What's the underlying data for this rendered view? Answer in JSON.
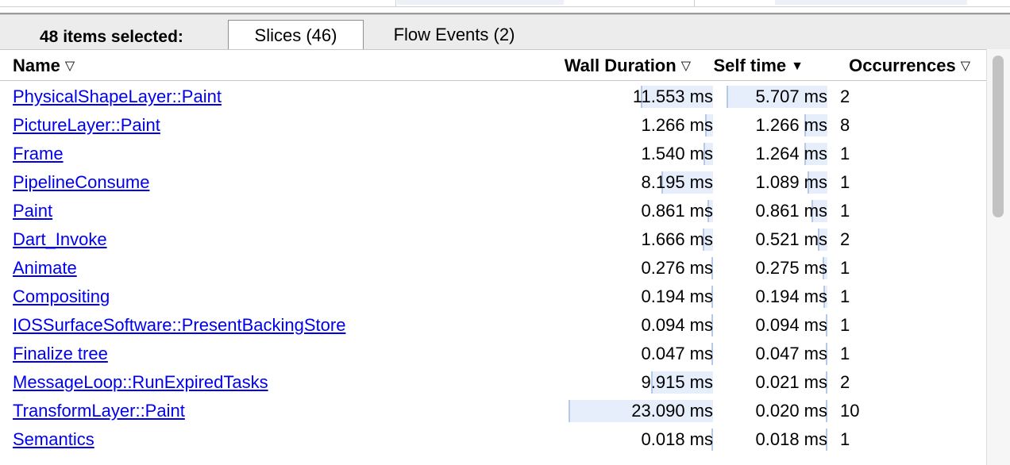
{
  "tabbar": {
    "selection_label": "48 items selected:",
    "tabs": [
      {
        "label": "Slices (46)"
      },
      {
        "label": "Flow Events (2)"
      }
    ]
  },
  "columns": {
    "name": "Name",
    "wall": "Wall Duration",
    "self": "Self time",
    "occ": "Occurrences",
    "sort_icons": {
      "name": "triangle-down-outline-icon",
      "wall": "triangle-down-outline-icon",
      "self": "triangle-down-filled-icon",
      "occ": "triangle-down-outline-icon"
    }
  },
  "colors": {
    "link": "#0000ee",
    "bar_fill": "#e6eefb",
    "bar_edge": "#b7c9ea"
  },
  "rows": [
    {
      "name": "PhysicalShapeLayer::Paint",
      "wall": "11.553 ms",
      "self": "5.707 ms",
      "occ": "2",
      "wall_frac": 0.5,
      "self_frac": 0.95
    },
    {
      "name": "PictureLayer::Paint",
      "wall": "1.266 ms",
      "self": "1.266 ms",
      "occ": "8",
      "wall_frac": 0.055,
      "self_frac": 0.22
    },
    {
      "name": "Frame",
      "wall": "1.540 ms",
      "self": "1.264 ms",
      "occ": "1",
      "wall_frac": 0.067,
      "self_frac": 0.22
    },
    {
      "name": "PipelineConsume",
      "wall": "8.195 ms",
      "self": "1.089 ms",
      "occ": "1",
      "wall_frac": 0.355,
      "self_frac": 0.19
    },
    {
      "name": "Paint",
      "wall": "0.861 ms",
      "self": "0.861 ms",
      "occ": "1",
      "wall_frac": 0.037,
      "self_frac": 0.15
    },
    {
      "name": "Dart_Invoke",
      "wall": "1.666 ms",
      "self": "0.521 ms",
      "occ": "2",
      "wall_frac": 0.072,
      "self_frac": 0.09
    },
    {
      "name": "Animate",
      "wall": "0.276 ms",
      "self": "0.275 ms",
      "occ": "1",
      "wall_frac": 0.012,
      "self_frac": 0.048
    },
    {
      "name": "Compositing",
      "wall": "0.194 ms",
      "self": "0.194 ms",
      "occ": "1",
      "wall_frac": 0.009,
      "self_frac": 0.034
    },
    {
      "name": "IOSSurfaceSoftware::PresentBackingStore",
      "wall": "0.094 ms",
      "self": "0.094 ms",
      "occ": "1",
      "wall_frac": 0.005,
      "self_frac": 0.016
    },
    {
      "name": "Finalize tree",
      "wall": "0.047 ms",
      "self": "0.047 ms",
      "occ": "1",
      "wall_frac": 0.003,
      "self_frac": 0.008
    },
    {
      "name": "MessageLoop::RunExpiredTasks",
      "wall": "9.915 ms",
      "self": "0.021 ms",
      "occ": "2",
      "wall_frac": 0.43,
      "self_frac": 0.004
    },
    {
      "name": "TransformLayer::Paint",
      "wall": "23.090 ms",
      "self": "0.020 ms",
      "occ": "10",
      "wall_frac": 1.0,
      "self_frac": 0.004
    },
    {
      "name": "Semantics",
      "wall": "0.018 ms",
      "self": "0.018 ms",
      "occ": "1",
      "wall_frac": 0.001,
      "self_frac": 0.003
    }
  ]
}
